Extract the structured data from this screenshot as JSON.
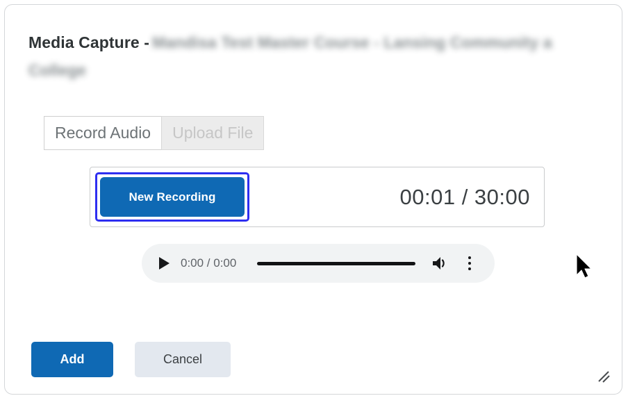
{
  "dialog": {
    "title_static": "Media Capture -",
    "title_course_line1": "Mandisa Test Master Course - Lansing Community  a",
    "title_course_line2": "College"
  },
  "source_tabs": [
    {
      "label": "Record Audio",
      "state": "enabled"
    },
    {
      "label": "Upload File",
      "state": "disabled"
    }
  ],
  "recorder": {
    "new_recording_label": "New Recording",
    "timer": "00:01 / 30:00",
    "elapsed": "00:01",
    "limit": "30:00",
    "focus_ring_color": "#2e2ef0"
  },
  "audio_player": {
    "play_icon": "play-icon",
    "time": "0:00 / 0:00",
    "current_time": "0:00",
    "duration": "0:00",
    "progress_percent": 0,
    "volume_icon": "volume-icon",
    "more_icon": "more-vertical-icon"
  },
  "footer": {
    "add_label": "Add",
    "cancel_label": "Cancel"
  },
  "colors": {
    "primary_blue": "#0f69b4",
    "focus_blue": "#2e2ef0",
    "cancel_grey": "#e3e8ef",
    "disabled_grey": "#ececec",
    "player_bg": "#f1f3f4"
  },
  "resize_grip": "resize-grip-icon",
  "cursor": "mouse-pointer"
}
